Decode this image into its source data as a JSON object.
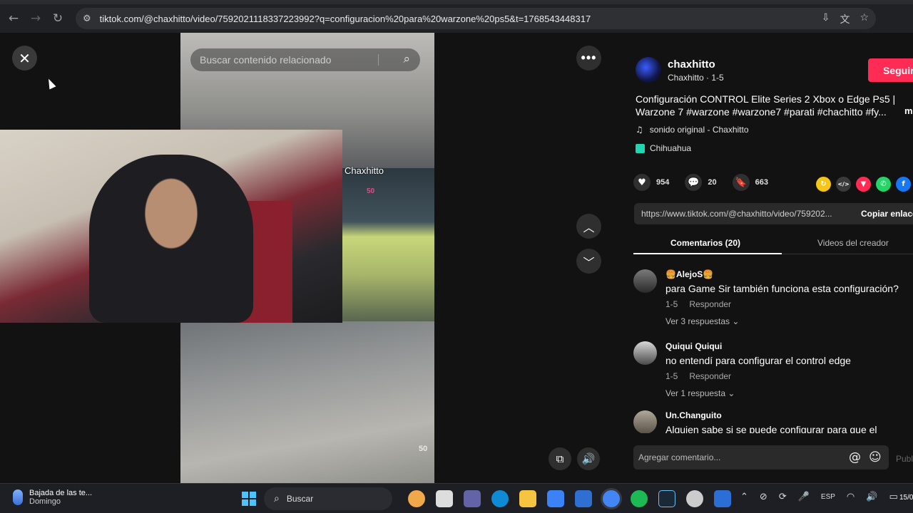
{
  "browser": {
    "url": "tiktok.com/@chaxhitto/video/7592021118337223992?q=configuracion%20para%20warzone%20ps5&t=1768543448317",
    "nav": {
      "back": "←",
      "forward": "→",
      "reload": "↻",
      "site_info": "⚙"
    },
    "right_icons": [
      "⇩",
      "文",
      "☆"
    ]
  },
  "player": {
    "close_glyph": "✕",
    "more_glyph": "•••",
    "up_glyph": "︿",
    "down_glyph": "﹀",
    "pip_glyph": "⧉",
    "volume_glyph": "🔊",
    "search_placeholder": "Buscar contenido relacionado",
    "search_glyph": "⌕",
    "watermark": "Chaxhitto",
    "hud_value_1": "50",
    "hud_value_2": "50"
  },
  "panel": {
    "author_name": "chaxhitto",
    "author_sub": "Chaxhitto · 1-5",
    "follow_label": "Seguir",
    "description": "Configuración CONTROL Elite Series 2 Xbox o Edge Ps5 | Warzone 7 #warzone #warzone7 #parati #chachitto #fy...",
    "more_label": "m",
    "music": "sonido original - Chaxhitto",
    "music_glyph": "♫",
    "location": "Chihuahua",
    "stats": {
      "likes": "954",
      "comments": "20",
      "saves": "663",
      "like_glyph": "♥",
      "comment_glyph": "💬",
      "save_glyph": "🔖"
    },
    "share_colors": [
      "#f5c518",
      "#3a3a3a",
      "#fe2c55",
      "#25d366",
      "#1877f2"
    ],
    "share_glyphs": [
      "↻",
      "</>",
      "▼",
      "✆",
      "f"
    ],
    "link": "https://www.tiktok.com/@chaxhitto/video/759202...",
    "copy_label": "Copiar enlace",
    "tabs": [
      "Comentarios (20)",
      "Videos del creador"
    ],
    "comments": [
      {
        "user": "🍔AlejoS🍔",
        "text": "para Game Sir también funciona esta configuración?",
        "date": "1-5",
        "reply": "Responder",
        "replies": "Ver 3 respuestas ⌄"
      },
      {
        "user": "Quiqui Quiqui",
        "text": "no entendí para configurar el control edge",
        "date": "1-5",
        "reply": "Responder",
        "replies": "Ver 1 respuesta ⌄"
      },
      {
        "user": "Un.Changuito",
        "text": "Alguien sabe si se puede configurar para que el"
      }
    ],
    "composer_placeholder": "Agregar comentario...",
    "mention_glyph": "@",
    "emoji_glyph": "☺",
    "post_label": "Publ"
  },
  "taskbar": {
    "weather_title": "Bajada de las te...",
    "weather_sub": "Domingo",
    "search_label": "Buscar",
    "search_glyph": "⌕",
    "app_colors": [
      "#f0a84a",
      "#dddddd",
      "#6264a7",
      "#0f8bd6",
      "#f5c542",
      "#3b82f6",
      "#2f6fd1",
      "#4285f4",
      "#1db954",
      "#1b2838",
      "#cccccc",
      "#2b6fd6"
    ],
    "tray": [
      "⌃",
      "⊘",
      "⟳",
      "🎤"
    ],
    "lang": "ESP",
    "tray_right": [
      "◠",
      "🔊",
      "▭"
    ],
    "clock": "15/0"
  }
}
